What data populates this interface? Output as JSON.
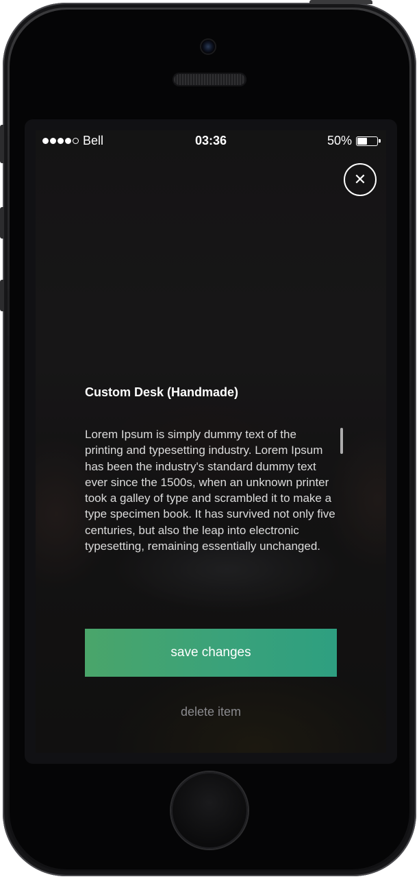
{
  "status_bar": {
    "carrier": "Bell",
    "signal_bars_filled": 4,
    "signal_bars_total": 5,
    "time": "03:36",
    "battery_text": "50%",
    "battery_level": 0.5
  },
  "close_button": {
    "icon": "close-icon",
    "glyph": "✕"
  },
  "item": {
    "title": "Custom Desk (Handmade)",
    "description": "Lorem Ipsum is simply dummy text of the printing and typesetting industry. Lorem Ipsum has been the industry's standard dummy text ever since the 1500s, when an unknown printer took a galley of type and scrambled it to make a type specimen book. It has survived not only five centuries, but also the leap into electronic typesetting, remaining essentially unchanged."
  },
  "actions": {
    "save_label": "save changes",
    "delete_label": "delete item"
  },
  "colors": {
    "accent_start": "#4aa56a",
    "accent_end": "#2e9f80",
    "muted_text": "#8a8a8e"
  }
}
